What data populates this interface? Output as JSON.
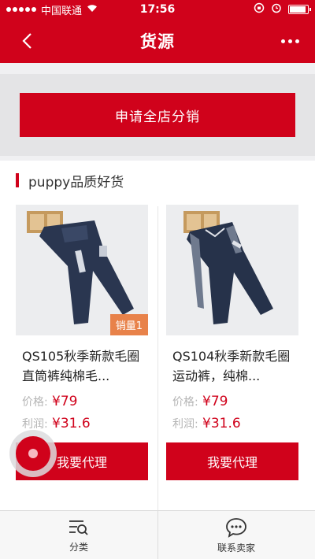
{
  "status_bar": {
    "carrier": "中国联通",
    "time": "17:56"
  },
  "nav": {
    "title": "货源"
  },
  "apply_button_label": "申请全店分销",
  "section": {
    "title": "puppy品质好货"
  },
  "products": [
    {
      "name": "QS105秋季新款毛圈直筒裤纯棉毛...",
      "sales_badge": "销量1",
      "price_label": "价格:",
      "price": "¥79",
      "profit_label": "利润:",
      "profit": "¥31.6",
      "button_label": "我要代理"
    },
    {
      "name": "QS104秋季新款毛圈运动裤，纯棉...",
      "price_label": "价格:",
      "price": "¥79",
      "profit_label": "利润:",
      "profit": "¥31.6",
      "button_label": "我要代理"
    }
  ],
  "tab_bar": {
    "tabs": [
      {
        "label": "分类",
        "icon": "category-list-icon"
      },
      {
        "label": "联系卖家",
        "icon": "chat-bubble-icon"
      }
    ]
  },
  "colors": {
    "brand_red": "#d0021b",
    "badge_orange": "#e8824a"
  }
}
